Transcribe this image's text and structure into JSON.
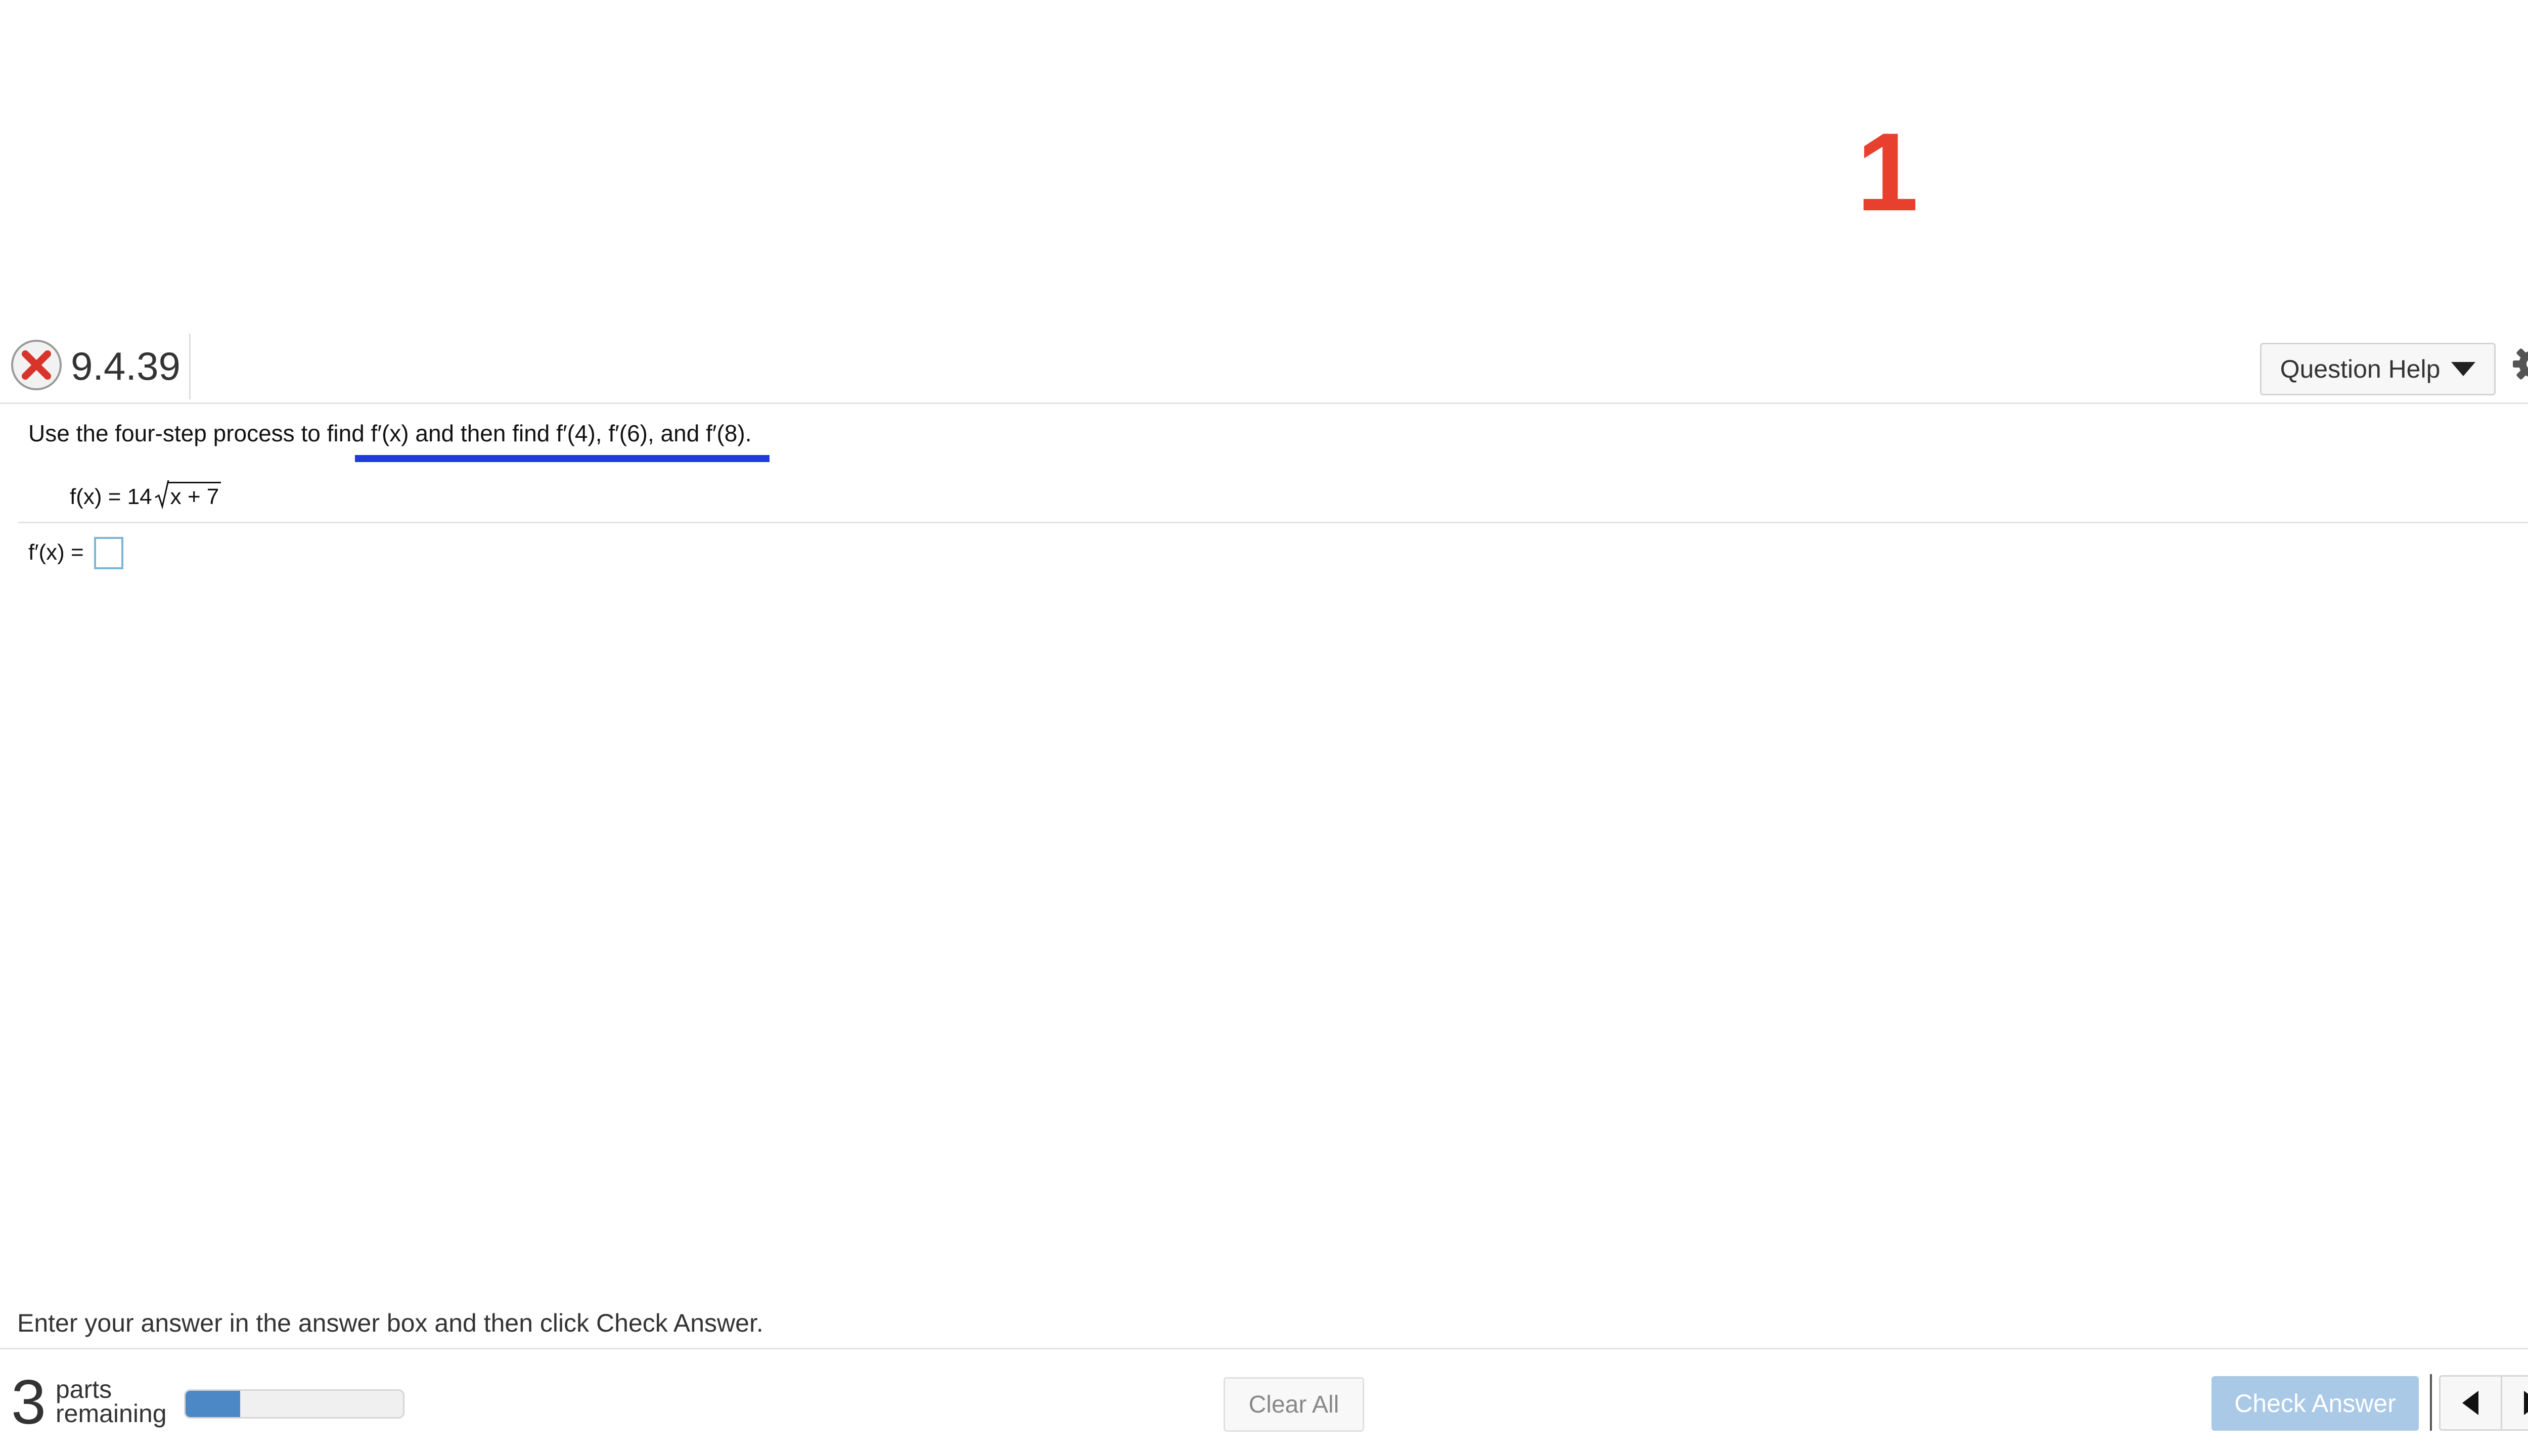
{
  "annotation": {
    "number": "1"
  },
  "header": {
    "question_number": "9.4.39",
    "status_icon": "incorrect-x-icon",
    "help_label": "Question Help",
    "settings_icon": "gear-icon"
  },
  "question": {
    "prompt": "Use the four-step process to find f′(x) and then find f′(4), f′(6), and f′(8).",
    "function_prefix": "f(x) = 14",
    "function_radicand": "x + 7",
    "answer_label": "f′(x) =",
    "answer_value": ""
  },
  "footer": {
    "instruction": "Enter your answer in the answer box and then click Check Answer.",
    "parts_count": "3",
    "parts_word": "parts",
    "remaining_word": "remaining",
    "progress_fraction": 0.25,
    "clear_label": "Clear All",
    "check_label": "Check Answer",
    "help_icon": "question-mark-icon",
    "prev_icon": "previous-arrow-icon",
    "next_icon": "next-arrow-icon"
  },
  "colors": {
    "annotation": "#e8402f",
    "underline": "#1f3be0",
    "progress_fill": "#4d88c6",
    "check_button": "#a9c9e6",
    "incorrect": "#d9342b",
    "help_circle": "#f2c230"
  }
}
